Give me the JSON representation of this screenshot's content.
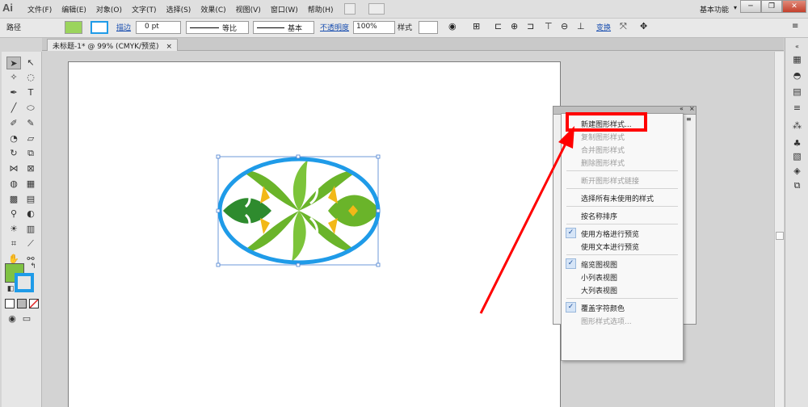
{
  "app": {
    "logo": "Ai"
  },
  "menubar": {
    "items": [
      "文件(F)",
      "编辑(E)",
      "对象(O)",
      "文字(T)",
      "选择(S)",
      "效果(C)",
      "视图(V)",
      "窗口(W)",
      "帮助(H)"
    ],
    "workspace": "基本功能",
    "workspace_arrow": "▾",
    "window_buttons": [
      "─",
      "❐",
      "✕"
    ]
  },
  "controlbar": {
    "object_label": "路径",
    "stroke_link": "描边",
    "stroke_value": "0 pt",
    "profile1": "等比",
    "profile2": "基本",
    "opacity_link": "不透明度",
    "opacity_value": "100%",
    "style_label": "样式",
    "transform_link": "变换"
  },
  "document": {
    "tab_title": "未标题-1* @ 99% (CMYK/预览)",
    "tab_close": "×"
  },
  "graphic_styles_menu": {
    "items": [
      {
        "label": "新建图形样式...",
        "enabled": true,
        "checked": false
      },
      {
        "label": "复制图形样式",
        "enabled": false,
        "checked": false
      },
      {
        "label": "合并图形样式",
        "enabled": false,
        "checked": false
      },
      {
        "label": "删除图形样式",
        "enabled": false,
        "checked": false
      },
      {
        "label": "断开图形样式链接",
        "enabled": false,
        "checked": false
      },
      {
        "label": "选择所有未使用的样式",
        "enabled": true,
        "checked": false
      },
      {
        "label": "按名称排序",
        "enabled": true,
        "checked": false
      },
      {
        "label": "使用方格进行预览",
        "enabled": true,
        "checked": true
      },
      {
        "label": "使用文本进行预览",
        "enabled": true,
        "checked": false
      },
      {
        "label": "缩览图视图",
        "enabled": true,
        "checked": true
      },
      {
        "label": "小列表视图",
        "enabled": true,
        "checked": false
      },
      {
        "label": "大列表视图",
        "enabled": true,
        "checked": false
      },
      {
        "label": "覆盖字符颜色",
        "enabled": true,
        "checked": true
      },
      {
        "label": "图形样式选项...",
        "enabled": false,
        "checked": false
      }
    ],
    "check_glyph": "✓"
  },
  "colors": {
    "ellipse_stroke": "#1f9be8",
    "leaf_green": "#6ab42a",
    "dark_green": "#2e8b2e",
    "accent_yellow": "#f2b818",
    "annotation_red": "#ff0000"
  }
}
